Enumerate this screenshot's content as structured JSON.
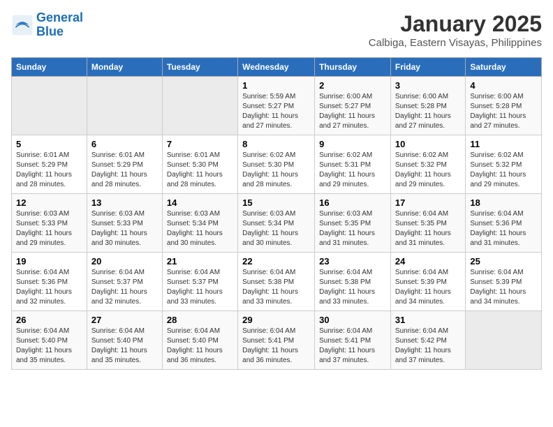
{
  "logo": {
    "text_general": "General",
    "text_blue": "Blue"
  },
  "title": "January 2025",
  "subtitle": "Calbiga, Eastern Visayas, Philippines",
  "days_of_week": [
    "Sunday",
    "Monday",
    "Tuesday",
    "Wednesday",
    "Thursday",
    "Friday",
    "Saturday"
  ],
  "weeks": [
    [
      {
        "day": "",
        "detail": ""
      },
      {
        "day": "",
        "detail": ""
      },
      {
        "day": "",
        "detail": ""
      },
      {
        "day": "1",
        "detail": "Sunrise: 5:59 AM\nSunset: 5:27 PM\nDaylight: 11 hours and 27 minutes."
      },
      {
        "day": "2",
        "detail": "Sunrise: 6:00 AM\nSunset: 5:27 PM\nDaylight: 11 hours and 27 minutes."
      },
      {
        "day": "3",
        "detail": "Sunrise: 6:00 AM\nSunset: 5:28 PM\nDaylight: 11 hours and 27 minutes."
      },
      {
        "day": "4",
        "detail": "Sunrise: 6:00 AM\nSunset: 5:28 PM\nDaylight: 11 hours and 27 minutes."
      }
    ],
    [
      {
        "day": "5",
        "detail": "Sunrise: 6:01 AM\nSunset: 5:29 PM\nDaylight: 11 hours and 28 minutes."
      },
      {
        "day": "6",
        "detail": "Sunrise: 6:01 AM\nSunset: 5:29 PM\nDaylight: 11 hours and 28 minutes."
      },
      {
        "day": "7",
        "detail": "Sunrise: 6:01 AM\nSunset: 5:30 PM\nDaylight: 11 hours and 28 minutes."
      },
      {
        "day": "8",
        "detail": "Sunrise: 6:02 AM\nSunset: 5:30 PM\nDaylight: 11 hours and 28 minutes."
      },
      {
        "day": "9",
        "detail": "Sunrise: 6:02 AM\nSunset: 5:31 PM\nDaylight: 11 hours and 29 minutes."
      },
      {
        "day": "10",
        "detail": "Sunrise: 6:02 AM\nSunset: 5:32 PM\nDaylight: 11 hours and 29 minutes."
      },
      {
        "day": "11",
        "detail": "Sunrise: 6:02 AM\nSunset: 5:32 PM\nDaylight: 11 hours and 29 minutes."
      }
    ],
    [
      {
        "day": "12",
        "detail": "Sunrise: 6:03 AM\nSunset: 5:33 PM\nDaylight: 11 hours and 29 minutes."
      },
      {
        "day": "13",
        "detail": "Sunrise: 6:03 AM\nSunset: 5:33 PM\nDaylight: 11 hours and 30 minutes."
      },
      {
        "day": "14",
        "detail": "Sunrise: 6:03 AM\nSunset: 5:34 PM\nDaylight: 11 hours and 30 minutes."
      },
      {
        "day": "15",
        "detail": "Sunrise: 6:03 AM\nSunset: 5:34 PM\nDaylight: 11 hours and 30 minutes."
      },
      {
        "day": "16",
        "detail": "Sunrise: 6:03 AM\nSunset: 5:35 PM\nDaylight: 11 hours and 31 minutes."
      },
      {
        "day": "17",
        "detail": "Sunrise: 6:04 AM\nSunset: 5:35 PM\nDaylight: 11 hours and 31 minutes."
      },
      {
        "day": "18",
        "detail": "Sunrise: 6:04 AM\nSunset: 5:36 PM\nDaylight: 11 hours and 31 minutes."
      }
    ],
    [
      {
        "day": "19",
        "detail": "Sunrise: 6:04 AM\nSunset: 5:36 PM\nDaylight: 11 hours and 32 minutes."
      },
      {
        "day": "20",
        "detail": "Sunrise: 6:04 AM\nSunset: 5:37 PM\nDaylight: 11 hours and 32 minutes."
      },
      {
        "day": "21",
        "detail": "Sunrise: 6:04 AM\nSunset: 5:37 PM\nDaylight: 11 hours and 33 minutes."
      },
      {
        "day": "22",
        "detail": "Sunrise: 6:04 AM\nSunset: 5:38 PM\nDaylight: 11 hours and 33 minutes."
      },
      {
        "day": "23",
        "detail": "Sunrise: 6:04 AM\nSunset: 5:38 PM\nDaylight: 11 hours and 33 minutes."
      },
      {
        "day": "24",
        "detail": "Sunrise: 6:04 AM\nSunset: 5:39 PM\nDaylight: 11 hours and 34 minutes."
      },
      {
        "day": "25",
        "detail": "Sunrise: 6:04 AM\nSunset: 5:39 PM\nDaylight: 11 hours and 34 minutes."
      }
    ],
    [
      {
        "day": "26",
        "detail": "Sunrise: 6:04 AM\nSunset: 5:40 PM\nDaylight: 11 hours and 35 minutes."
      },
      {
        "day": "27",
        "detail": "Sunrise: 6:04 AM\nSunset: 5:40 PM\nDaylight: 11 hours and 35 minutes."
      },
      {
        "day": "28",
        "detail": "Sunrise: 6:04 AM\nSunset: 5:40 PM\nDaylight: 11 hours and 36 minutes."
      },
      {
        "day": "29",
        "detail": "Sunrise: 6:04 AM\nSunset: 5:41 PM\nDaylight: 11 hours and 36 minutes."
      },
      {
        "day": "30",
        "detail": "Sunrise: 6:04 AM\nSunset: 5:41 PM\nDaylight: 11 hours and 37 minutes."
      },
      {
        "day": "31",
        "detail": "Sunrise: 6:04 AM\nSunset: 5:42 PM\nDaylight: 11 hours and 37 minutes."
      },
      {
        "day": "",
        "detail": ""
      }
    ]
  ]
}
